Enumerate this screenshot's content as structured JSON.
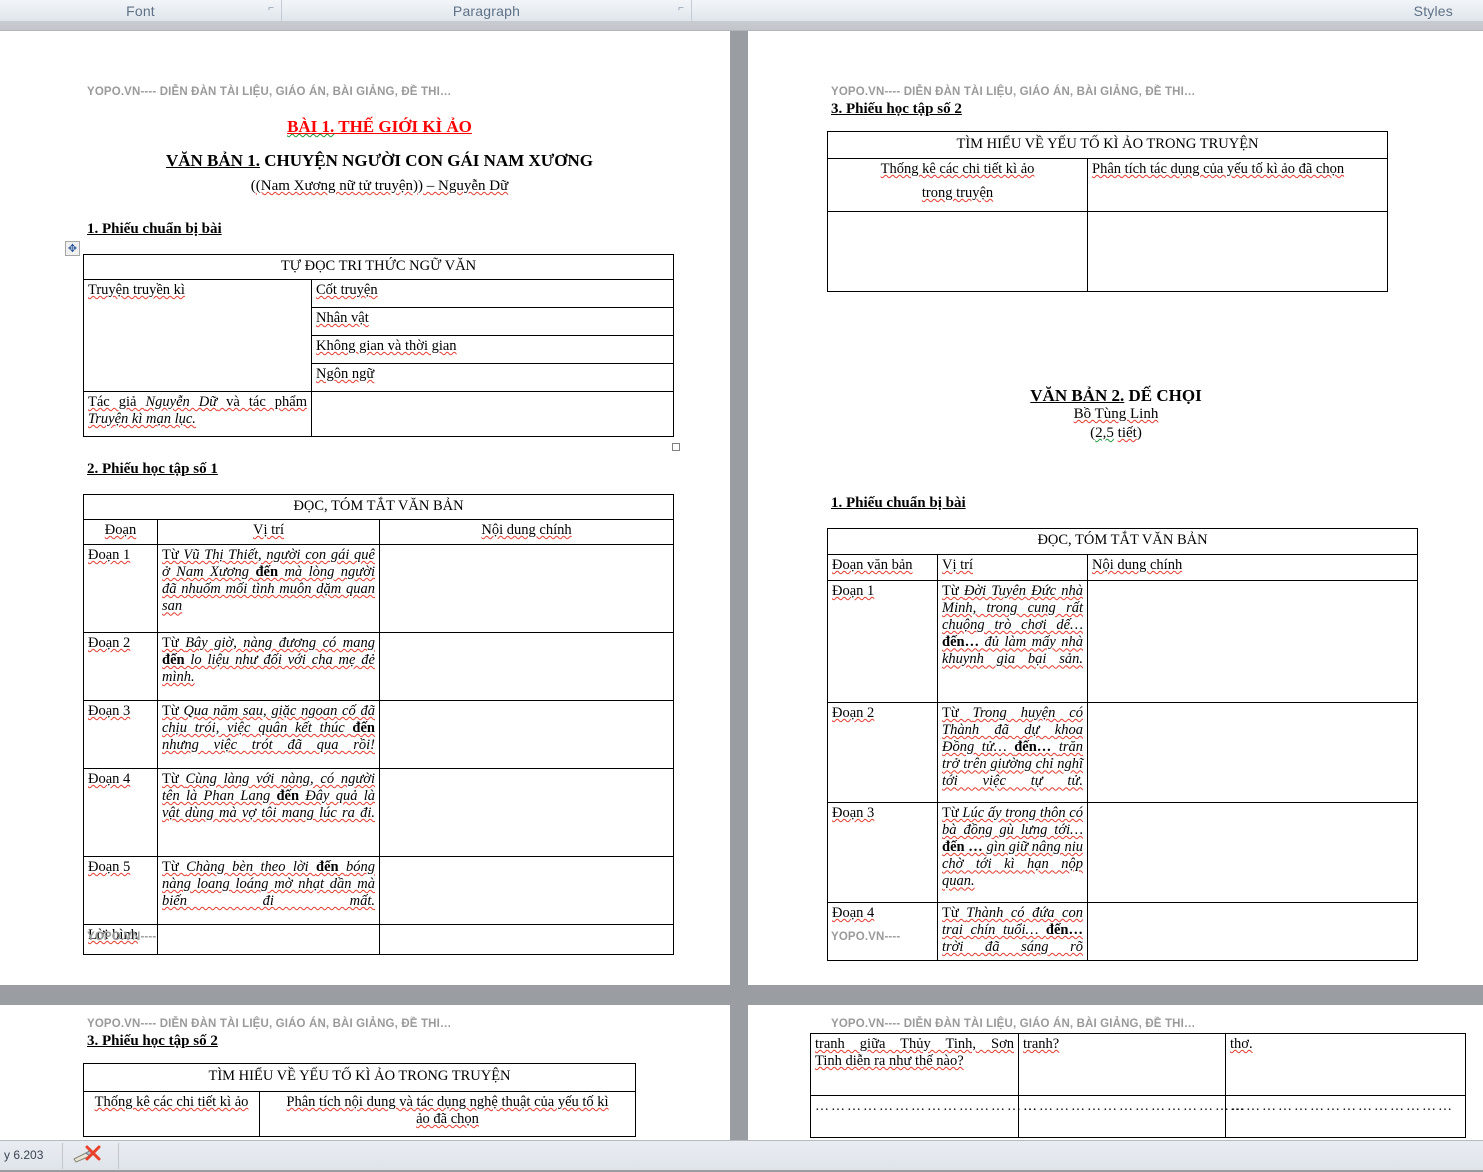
{
  "ribbon": {
    "groups": [
      {
        "label": "Font"
      },
      {
        "label": "Paragraph"
      },
      {
        "label": "Styles"
      }
    ],
    "launcher_glyph": "⌐"
  },
  "watermark": {
    "full": "YOPO.VN---- DIỄN ĐÀN TÀI LIỆU, GIÁO ÁN, BÀI GIẢNG, ĐỀ THI…",
    "short": "YOPO.VN----"
  },
  "page1": {
    "lesson_title_underlined": "BÀI 1.",
    "lesson_title_rest": " THẾ GIỚI KÌ ẢO",
    "text_title_underlined": "VĂN BẢN 1.",
    "text_title_rest": " CHUYỆN NGƯỜI CON GÁI NAM XƯƠNG",
    "text_subtitle_a": "(Nam Xương nữ tử truyện)",
    "text_subtitle_b": " – Nguyễn Dữ",
    "section1": "1. Phiếu chuẩn bị bài",
    "table1": {
      "header": "TỰ ĐỌC TRI THỨC NGỮ VĂN",
      "left_label_1": "Truyện truyền kì",
      "right_items": [
        "Cốt truyện",
        "Nhân vật",
        "Không gian và thời gian",
        "Ngôn ngữ"
      ],
      "left_label_2_a": "Tác giả ",
      "left_label_2_b": "Nguyễn Dữ",
      "left_label_2_c": " và tác phẩm ",
      "left_label_2_d": "Truyện kì mạn lục."
    },
    "section2": "2. Phiếu học tập số 1",
    "table2": {
      "header": "ĐỌC, TÓM TẮT VĂN BẢN",
      "cols": [
        "Đoạn",
        "Vị trí",
        "Nội dung chính"
      ],
      "rows": [
        {
          "label": "Đoạn 1",
          "pos_pre": "Từ ",
          "pos_ital1": "Vũ Thị Thiết, người con gái quê ở Nam Xương ",
          "pos_mid": "đến ",
          "pos_ital2": "mà lòng người đã nhuốm mối tình muôn dặm quan san",
          "content": ""
        },
        {
          "label": "Đoạn 2",
          "pos_pre": "Từ ",
          "pos_ital1": "Bây giờ, nàng đương có mang ",
          "pos_mid": "đến ",
          "pos_ital2": "lo liệu như đối với cha mẹ đẻ mình.",
          "content": ""
        },
        {
          "label": "Đoạn 3",
          "pos_pre": "Từ ",
          "pos_ital1": "Qua năm sau, giặc ngoan cố đã chịu trói, việc quân kết thúc ",
          "pos_mid": "đến ",
          "pos_ital2": "nhưng việc trót đã qua rồi!",
          "content": ""
        },
        {
          "label": "Đoạn 4",
          "pos_pre": "Từ ",
          "pos_ital1": "Cùng làng với nàng, có người tên là Phan Lang ",
          "pos_mid": "đến ",
          "pos_ital2": "Đây quả là vật dùng mà vợ tôi mang lúc ra đi.",
          "content": ""
        },
        {
          "label": "Đoạn 5",
          "pos_pre": "Từ ",
          "pos_ital1": "Chàng bèn theo lời ",
          "pos_mid": "đến ",
          "pos_ital2": "bóng nàng loang loáng mờ nhạt dần mà biến đi mất.",
          "content": ""
        },
        {
          "label": "Lời bình",
          "pos_pre": "",
          "pos_ital1": "",
          "pos_mid": "",
          "pos_ital2": "",
          "content": ""
        }
      ]
    }
  },
  "page2": {
    "section3": "3. Phiếu học tập số 2",
    "table3": {
      "header": "TÌM HIỂU VỀ YẾU TỐ KÌ ẢO TRONG TRUYỆN",
      "col_left_line1": "Thống kê các chi tiết kì ảo",
      "col_left_line2": "trong truyện",
      "col_right": "Phân tích tác dụng của yếu tố kì ảo đã chọn",
      "cell_left": "",
      "cell_right": ""
    },
    "text2_title_underlined": "VĂN BẢN 2.",
    "text2_title_rest": " DẾ CHỌI",
    "text2_author": "Bồ Tùng Linh",
    "text2_duration": "(2,5 tiết)",
    "section1": "1. Phiếu chuẩn bị bài",
    "table4": {
      "header": "ĐỌC, TÓM TẮT VĂN BẢN",
      "cols": [
        "Đoạn văn bản",
        "Vị trí",
        "Nội dung chính"
      ],
      "rows": [
        {
          "label": "Đoạn 1",
          "pos_pre": "Từ ",
          "pos_ital1": "Đời Tuyên Đức nhà Minh, trong cung rất chuộng trò chơi dế… ",
          "pos_mid": "đến… ",
          "pos_ital2": "đủ làm mấy nhà khuynh gia bại sản.",
          "content": ""
        },
        {
          "label": "Đoạn 2",
          "pos_pre": "Từ ",
          "pos_ital1": "Trong huyện có Thành đã dự khoa Đồng tử… ",
          "pos_mid": "đến… ",
          "pos_ital2": "trăn trở trên giường chỉ nghĩ tới việc tự tử.",
          "content": ""
        },
        {
          "label": "Đoạn 3",
          "pos_pre": "Từ ",
          "pos_ital1": "Lúc ấy trong thôn có bà đồng gù lưng tới… ",
          "pos_mid": "đến … ",
          "pos_ital2": "gìn giữ nâng niu chờ tới kì hạn nộp quan.",
          "content": ""
        },
        {
          "label": "Đoạn 4",
          "pos_pre": "Từ ",
          "pos_ital1": "Thành có đứa con trai chín tuổi… ",
          "pos_mid": "đến… ",
          "pos_ital2": "trời đã sáng rõ",
          "content": ""
        }
      ]
    }
  },
  "page3": {
    "section3": "3. Phiếu học tập số 2",
    "table": {
      "header": "TÌM HIỂU VỀ YẾU TỐ KÌ ẢO TRONG TRUYỆN",
      "col_left": "Thống kê các chi tiết kì ảo",
      "col_right_line1": "Phân tích nội dung và tác dụng nghệ thuật của yếu tố kì",
      "col_right_line2": "ảo đã chọn"
    }
  },
  "page4": {
    "table": {
      "c1_line1": "tranh giữa Thủy Tinh, Sơn",
      "c1_line2": "Tinh diễn ra như thế nào?",
      "c2": "tranh?",
      "c3": "thơ.",
      "dots": "……………………………………"
    }
  },
  "statusbar": {
    "text": "y 6.203"
  }
}
